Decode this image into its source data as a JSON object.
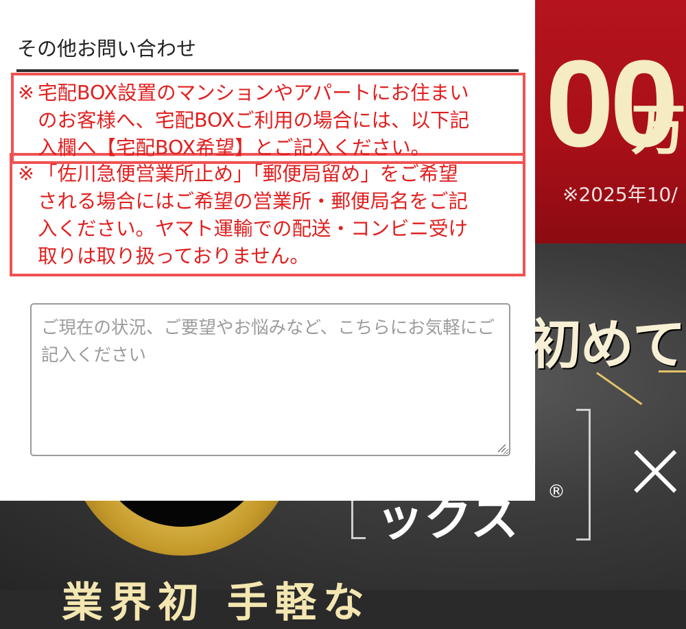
{
  "background": {
    "big_number": "00",
    "unit": "万",
    "note": "※2025年10/",
    "catch": "初めて!",
    "brand": "ックス",
    "reg": "®",
    "times": "×",
    "bottom_text": "業界初 手軽な"
  },
  "form": {
    "section_title": "その他お問い合わせ",
    "notice1": {
      "mark": "※",
      "line1": "宅配BOX設置のマンションやアパートにお住まい",
      "line2": "のお客様へ、宅配BOXご利用の場合には、以下記",
      "line3": "入欄へ【宅配BOX希望】とご記入ください。"
    },
    "notice2": {
      "mark": "※",
      "line1": "「佐川急便営業所止め」「郵便局留め」をご希望",
      "line2": "される場合にはご希望の営業所・郵便局名をご記",
      "line3": "入ください。ヤマト運輸での配送・コンビニ受け",
      "line4": "取りは取り扱っておりません。"
    },
    "textarea": {
      "value": "",
      "placeholder": "ご現在の状況、ご要望やお悩みなど、こちらにお気軽にご記入ください"
    }
  },
  "colors": {
    "notice_text": "#e02020",
    "notice_border": "#f05252",
    "banner_red": "#b5141c",
    "gold": "#f6ecc4"
  }
}
